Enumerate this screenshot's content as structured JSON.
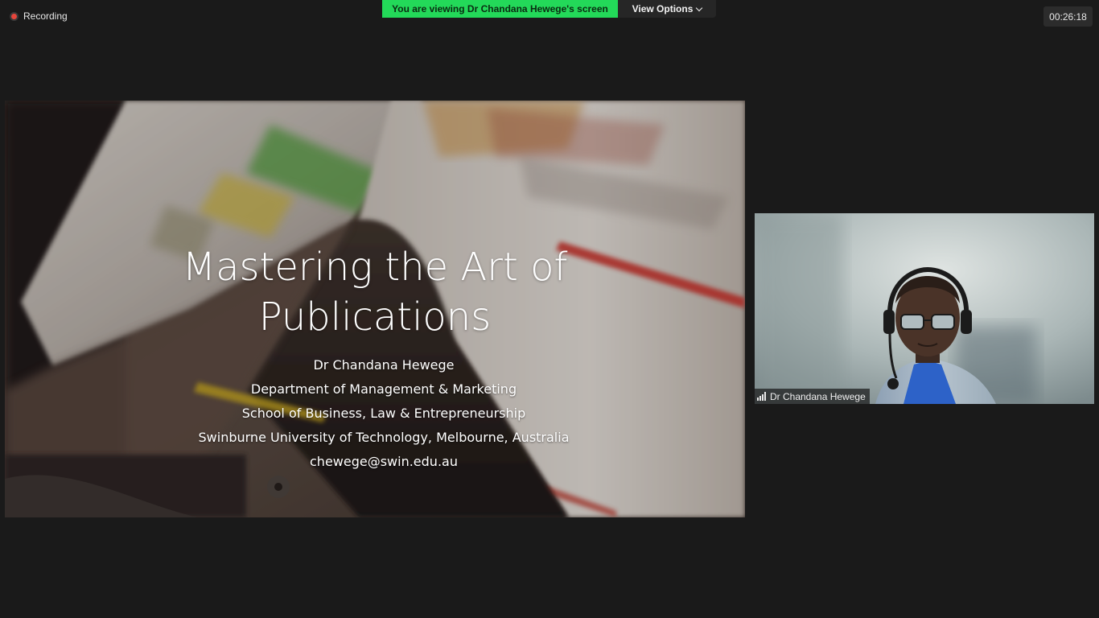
{
  "recording": {
    "label": "Recording",
    "icon": "recording-dot-icon"
  },
  "banner": {
    "viewing_text": "You are viewing Dr Chandana Hewege's screen",
    "view_options_label": "View Options",
    "view_options_icon": "chevron-down-icon",
    "banner_color": "#23d959"
  },
  "timer": {
    "elapsed": "00:26:18"
  },
  "slide": {
    "title_line1": "Mastering the Art of",
    "title_line2": "Publications",
    "presenter": "Dr Chandana Hewege",
    "department": "Department of Management & Marketing",
    "school": "School of Business, Law & Entrepreneurship",
    "university": "Swinburne University of Technology, Melbourne, Australia",
    "email": "chewege@swin.edu.au"
  },
  "participant": {
    "name": "Dr Chandana Hewege",
    "signal_icon": "signal-strength-icon"
  },
  "colors": {
    "background": "#1a1a1a",
    "accent_green": "#23d959",
    "recording_red": "#e5453b"
  }
}
